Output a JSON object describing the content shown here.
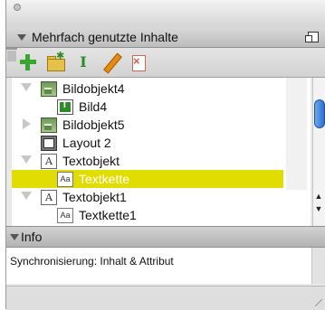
{
  "panel": {
    "title": "Mehrfach genutzte Inhalte",
    "icons": [
      "add-icon",
      "new-folder-icon",
      "text-cursor-icon",
      "edit-pencil-icon",
      "remove-link-icon",
      "trash-icon"
    ]
  },
  "tree": {
    "items": [
      {
        "label": "Bildobjekt4",
        "icon": "image-object-icon",
        "expander": "open"
      },
      {
        "label": "Bild4",
        "icon": "image-chain-icon",
        "expander": "none"
      },
      {
        "label": "Bildobjekt5",
        "icon": "image-object-icon",
        "expander": "closed"
      },
      {
        "label": "Layout 2",
        "icon": "layout-icon",
        "expander": "none"
      },
      {
        "label": "Textobjekt",
        "icon": "text-object-icon",
        "expander": "open"
      },
      {
        "label": "Textkette",
        "icon": "text-chain-icon",
        "expander": "none",
        "selected": true
      },
      {
        "label": "Textobjekt1",
        "icon": "text-object-icon",
        "expander": "open"
      },
      {
        "label": "Textkette1",
        "icon": "text-chain-icon",
        "expander": "none"
      }
    ],
    "text_object_glyph": "A",
    "text_chain_glyph": "Aa"
  },
  "info": {
    "title": "Info",
    "text": "Synchronisierung: Inhalt & Attribut"
  },
  "colors": {
    "selection": "#e2dd00",
    "accent_scroll": "#2a6fd4"
  }
}
